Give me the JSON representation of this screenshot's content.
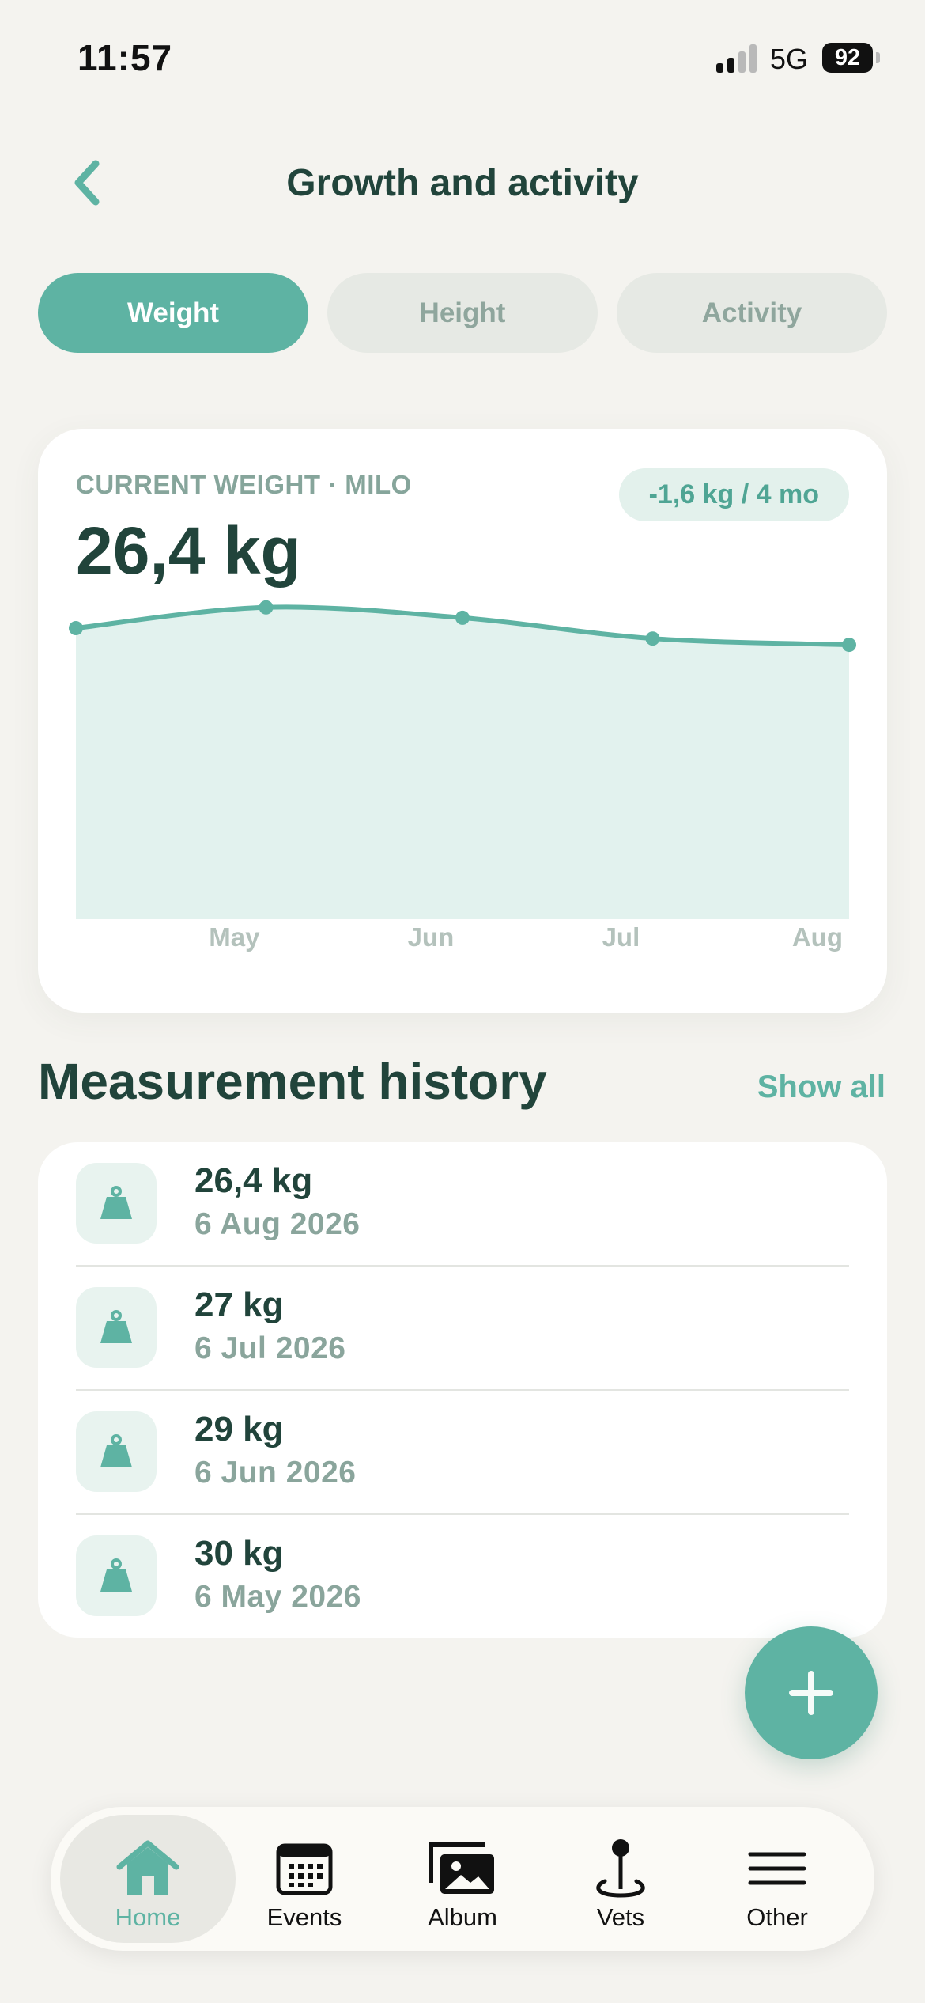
{
  "status_bar": {
    "time": "11:57",
    "network": "5G",
    "battery": "92"
  },
  "header": {
    "back_icon": "chevron-left-icon",
    "title": "Growth and activity"
  },
  "tabs": [
    {
      "label": "Weight",
      "active": true
    },
    {
      "label": "Height",
      "active": false
    },
    {
      "label": "Activity",
      "active": false
    }
  ],
  "weight_card": {
    "label": "CURRENT WEIGHT · MILO",
    "value": "26,4 kg",
    "delta": "-1,6 kg / 4 mo"
  },
  "chart_data": {
    "type": "area",
    "x": [
      "2026-04-06",
      "2026-05-06",
      "2026-06-06",
      "2026-07-06",
      "2026-08-06"
    ],
    "y": [
      28,
      30,
      29,
      27,
      26.4
    ],
    "tick_labels": [
      "May",
      "Jun",
      "Jul",
      "Aug"
    ],
    "xlabel": "",
    "ylabel": "",
    "grid": false,
    "colors": {
      "line": "#5eb3a3",
      "fill": "#e2f2ee",
      "point": "#5eb3a3"
    }
  },
  "history": {
    "title": "Measurement history",
    "show_all_label": "Show all",
    "items": [
      {
        "value": "26,4 kg",
        "date": "6 Aug 2026",
        "icon": "weight-icon"
      },
      {
        "value": "27 kg",
        "date": "6 Jul 2026",
        "icon": "weight-icon"
      },
      {
        "value": "29 kg",
        "date": "6 Jun 2026",
        "icon": "weight-icon"
      },
      {
        "value": "30 kg",
        "date": "6 May 2026",
        "icon": "weight-icon"
      }
    ]
  },
  "fab": {
    "icon": "plus-icon"
  },
  "bottom_nav": [
    {
      "label": "Home",
      "icon": "home-icon",
      "active": true
    },
    {
      "label": "Events",
      "icon": "calendar-icon",
      "active": false
    },
    {
      "label": "Album",
      "icon": "photos-icon",
      "active": false
    },
    {
      "label": "Vets",
      "icon": "location-pin-icon",
      "active": false
    },
    {
      "label": "Other",
      "icon": "menu-icon",
      "active": false
    }
  ],
  "colors": {
    "accent": "#5eb3a3",
    "text_dark": "#21443b",
    "text_muted": "#8aa59c",
    "background": "#f4f3ef"
  }
}
